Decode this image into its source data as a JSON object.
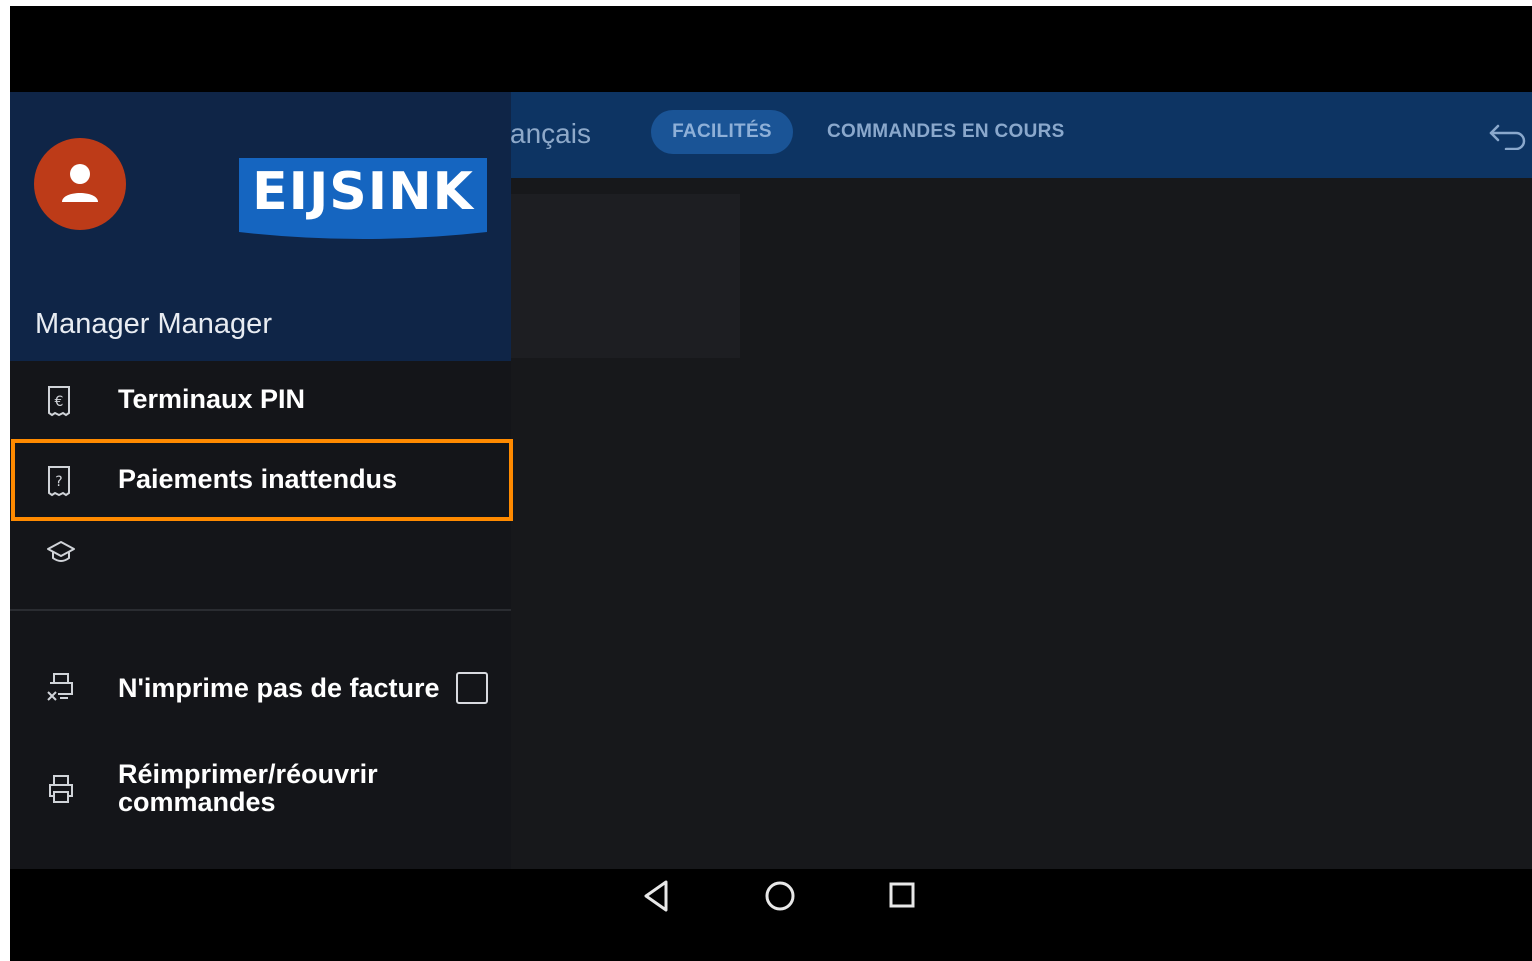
{
  "topbar": {
    "language_partial": "ançais",
    "tabs": [
      {
        "label": "FACILITÉS",
        "active": true
      },
      {
        "label": "COMMANDES EN COURS",
        "active": false
      }
    ],
    "back_icon": "undo-arrow-icon"
  },
  "drawer": {
    "avatar_icon": "user-icon",
    "logo_text": "EIJSINK",
    "user_name": "Manager Manager",
    "items": [
      {
        "label": "Terminaux PIN",
        "icon": "euro-receipt-icon"
      },
      {
        "label": "Paiements inattendus",
        "icon": "question-receipt-icon",
        "highlighted": true
      },
      {
        "label": "",
        "icon": "graduation-cap-icon"
      },
      {
        "label": "N'imprime pas de facture",
        "icon": "printer-cancel-icon",
        "checkbox": false
      },
      {
        "label_line1": "Réimprimer/réouvrir",
        "label_line2": "commandes",
        "icon": "printer-icon"
      }
    ]
  },
  "navbar": {
    "buttons": [
      "back-triangle-icon",
      "home-circle-icon",
      "recents-square-icon"
    ]
  },
  "colors": {
    "header_blue": "#0f2547",
    "topbar_blue": "#0d3463",
    "avatar_orange": "#bd3b18",
    "highlight_orange": "#ff8a00",
    "logo_blue": "#1565c0"
  }
}
